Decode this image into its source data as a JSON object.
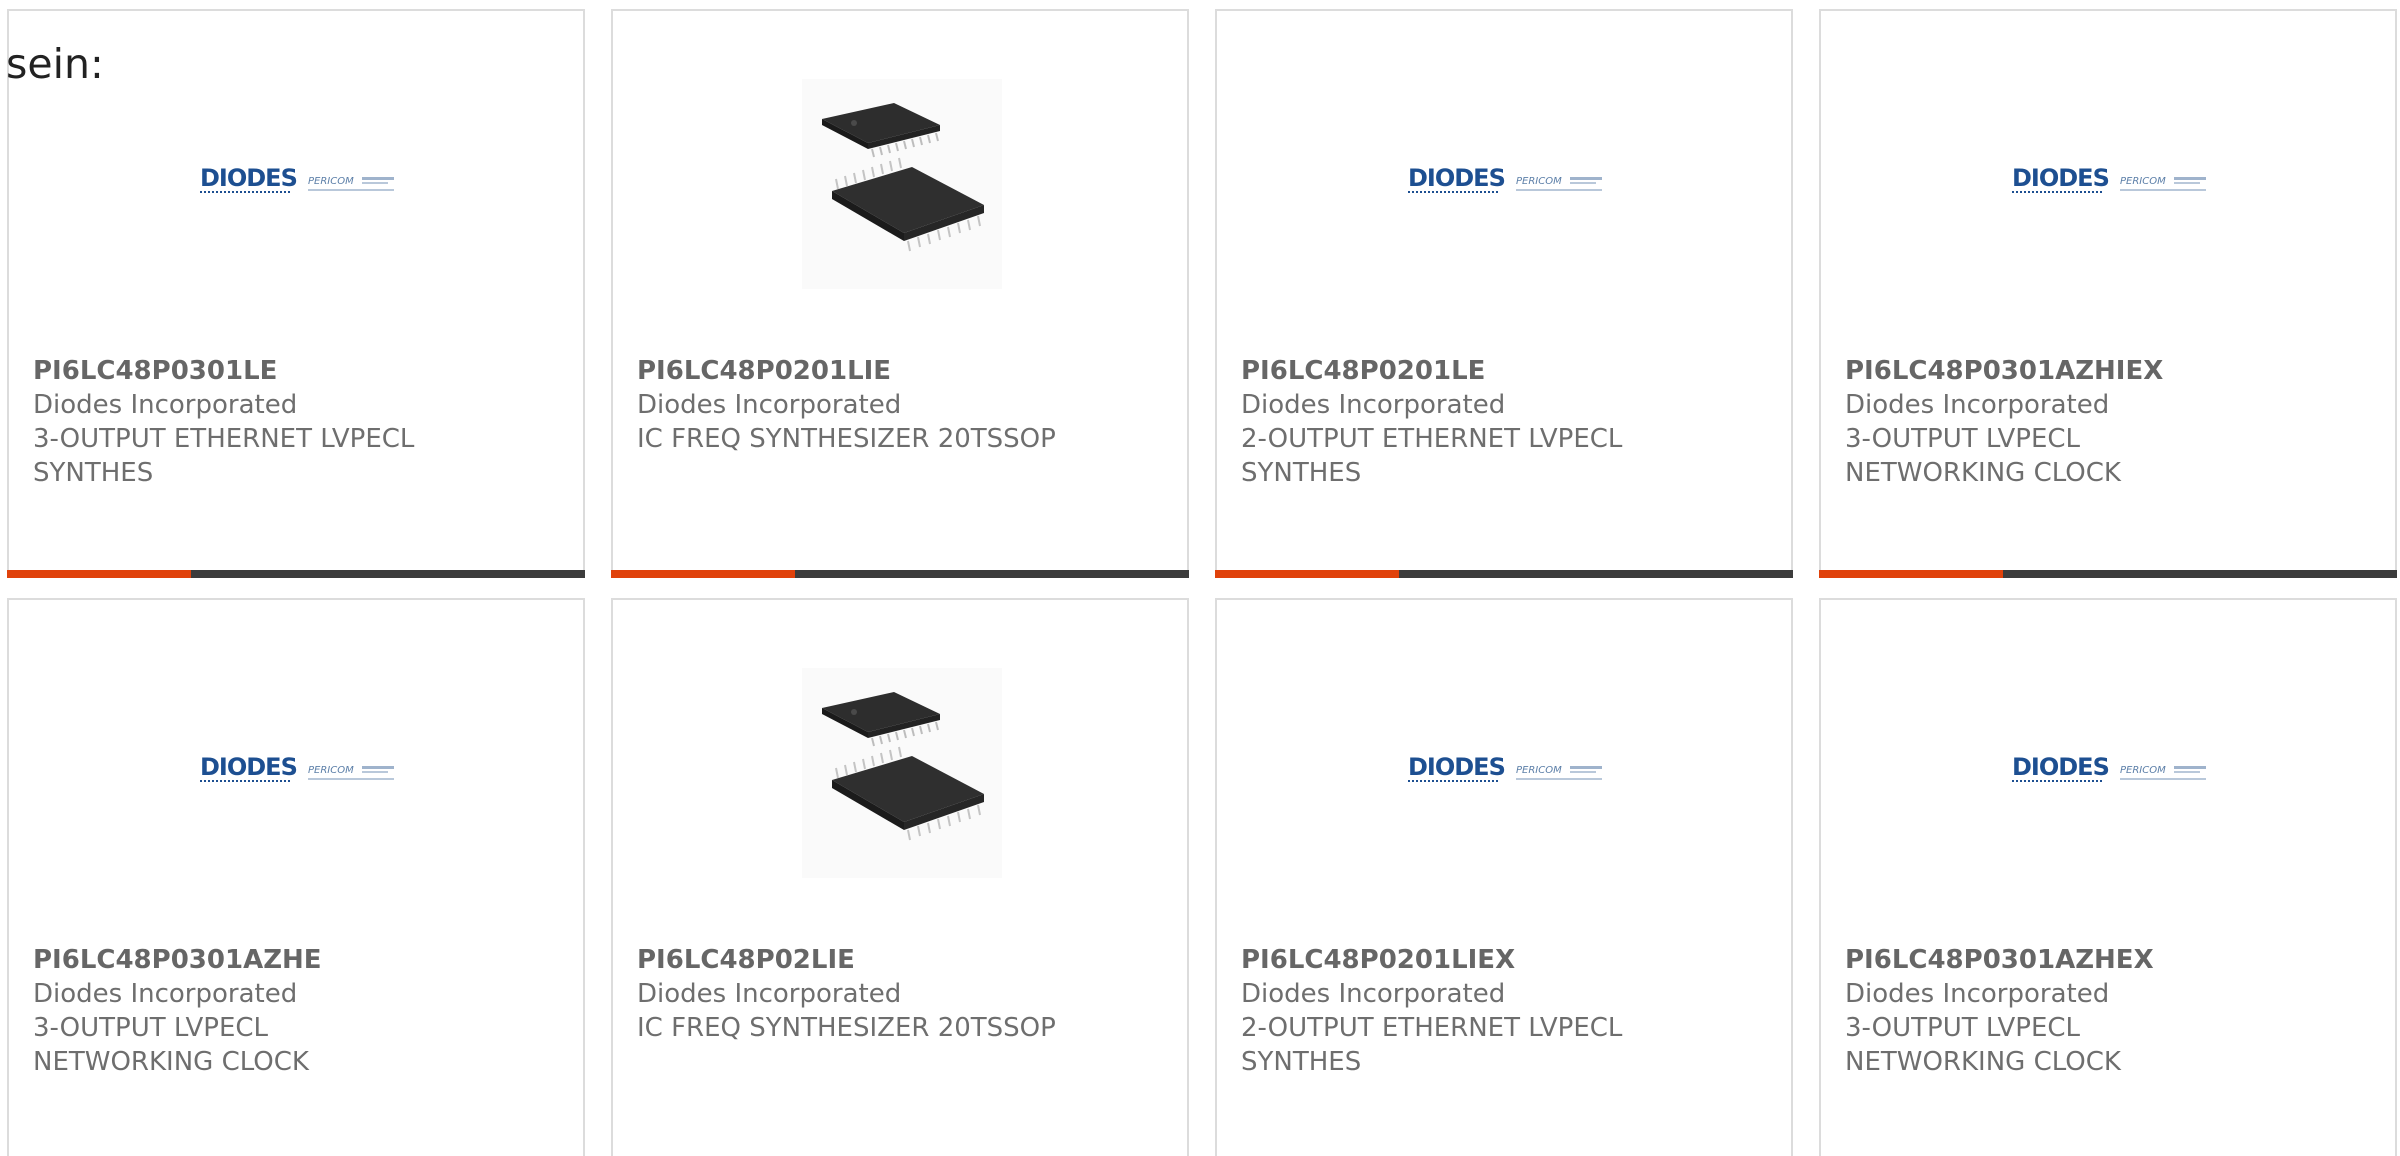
{
  "intro_text": "sein:",
  "colors": {
    "accent": "#e0420b",
    "bar": "#3c3c3c",
    "border": "#dcdcdc",
    "text": "#6e6e6e",
    "logo_blue": "#1d4f91"
  },
  "logo": {
    "brand": "DIODES",
    "sub": "PERICOM"
  },
  "products": [
    {
      "part": "PI6LC48P0301LE",
      "maker": "Diodes Incorporated",
      "desc": "3-OUTPUT ETHERNET LVPECL SYNTHES",
      "image": "diodes-pericom-logo",
      "has_bar": true
    },
    {
      "part": "PI6LC48P0201LIE",
      "maker": "Diodes Incorporated",
      "desc": "IC FREQ SYNTHESIZER 20TSSOP",
      "image": "tssop-chip-photo",
      "has_bar": true
    },
    {
      "part": "PI6LC48P0201LE",
      "maker": "Diodes Incorporated",
      "desc": "2-OUTPUT ETHERNET LVPECL SYNTHES",
      "image": "diodes-pericom-logo",
      "has_bar": true
    },
    {
      "part": "PI6LC48P0301AZHIEX",
      "maker": "Diodes Incorporated",
      "desc": "3-OUTPUT LVPECL NETWORKING CLOCK",
      "image": "diodes-pericom-logo",
      "has_bar": true
    },
    {
      "part": "PI6LC48P0301AZHE",
      "maker": "Diodes Incorporated",
      "desc": "3-OUTPUT LVPECL NETWORKING CLOCK",
      "image": "diodes-pericom-logo",
      "has_bar": false
    },
    {
      "part": "PI6LC48P02LIE",
      "maker": "Diodes Incorporated",
      "desc": "IC FREQ SYNTHESIZER 20TSSOP",
      "image": "tssop-chip-photo",
      "has_bar": false
    },
    {
      "part": "PI6LC48P0201LIEX",
      "maker": "Diodes Incorporated",
      "desc": "2-OUTPUT ETHERNET LVPECL SYNTHES",
      "image": "diodes-pericom-logo",
      "has_bar": false
    },
    {
      "part": "PI6LC48P0301AZHEX",
      "maker": "Diodes Incorporated",
      "desc": "3-OUTPUT LVPECL NETWORKING CLOCK",
      "image": "diodes-pericom-logo",
      "has_bar": false
    }
  ]
}
